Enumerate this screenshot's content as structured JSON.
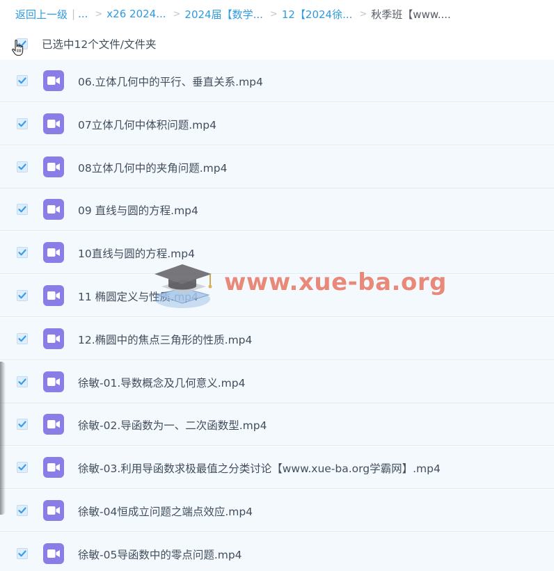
{
  "breadcrumb": {
    "back": "返回上一级",
    "bar": "|",
    "ellipsis": "...",
    "items": [
      "x26 2024...",
      "2024届【数学...",
      "12【2024徐..."
    ],
    "separator": ">",
    "current": "秋季班【www...."
  },
  "selection": {
    "label": "已选中12个文件/文件夹"
  },
  "files": [
    {
      "name": "06.立体几何中的平行、垂直关系.mp4",
      "icon": "video-file-icon",
      "checked": true
    },
    {
      "name": "07立体几何中体积问题.mp4",
      "icon": "video-file-icon",
      "checked": true
    },
    {
      "name": "08立体几何中的夹角问题.mp4",
      "icon": "video-file-icon",
      "checked": true
    },
    {
      "name": "09 直线与圆的方程.mp4",
      "icon": "video-file-icon",
      "checked": true
    },
    {
      "name": "10直线与圆的方程.mp4",
      "icon": "video-file-icon",
      "checked": true
    },
    {
      "name": "11 椭圆定义与性质.mp4",
      "icon": "video-file-icon",
      "checked": true
    },
    {
      "name": "12.椭圆中的焦点三角形的性质.mp4",
      "icon": "video-file-icon",
      "checked": true
    },
    {
      "name": "徐敏-01.导数概念及几何意义.mp4",
      "icon": "video-file-icon",
      "checked": true
    },
    {
      "name": "徐敏-02.导函数为一、二次函数型.mp4",
      "icon": "video-file-icon",
      "checked": true
    },
    {
      "name": "徐敏-03.利用导函数求极最值之分类讨论【www.xue-ba.org学霸网】.mp4",
      "icon": "video-file-icon",
      "checked": true
    },
    {
      "name": "徐敏-04恒成立问题之端点效应.mp4",
      "icon": "video-file-icon",
      "checked": true
    },
    {
      "name": "徐敏-05导函数中的零点问题.mp4",
      "icon": "video-file-icon",
      "checked": true
    }
  ],
  "watermark": {
    "text": "www.xue-ba.org"
  },
  "colors": {
    "link": "#2e9ae0",
    "row_bg": "#f4f9fe",
    "video_icon": "#8a7de6",
    "check": "#3a9ce6",
    "watermark": "#e25c46"
  }
}
